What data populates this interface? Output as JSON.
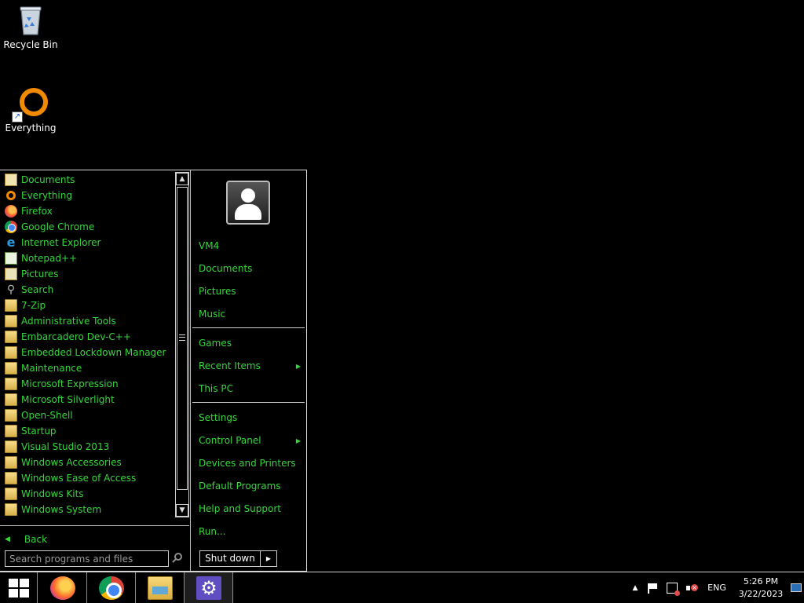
{
  "desktop": {
    "icons": [
      {
        "label": "Recycle Bin",
        "icon": "recycle-bin-icon"
      },
      {
        "label": "Everything",
        "icon": "everything-icon"
      }
    ]
  },
  "start_menu": {
    "programs": [
      {
        "label": "Documents",
        "icon": "documents-icon"
      },
      {
        "label": "Everything",
        "icon": "everything-icon"
      },
      {
        "label": "Firefox",
        "icon": "firefox-icon"
      },
      {
        "label": "Google Chrome",
        "icon": "chrome-icon"
      },
      {
        "label": "Internet Explorer",
        "icon": "internet-explorer-icon"
      },
      {
        "label": "Notepad++",
        "icon": "notepad-icon"
      },
      {
        "label": "Pictures",
        "icon": "pictures-icon"
      },
      {
        "label": "Search",
        "icon": "search-icon"
      },
      {
        "label": "7-Zip",
        "icon": "folder-icon"
      },
      {
        "label": "Administrative Tools",
        "icon": "folder-icon"
      },
      {
        "label": "Embarcadero Dev-C++",
        "icon": "folder-icon"
      },
      {
        "label": "Embedded Lockdown Manager",
        "icon": "folder-icon"
      },
      {
        "label": "Maintenance",
        "icon": "folder-icon"
      },
      {
        "label": "Microsoft Expression",
        "icon": "folder-icon"
      },
      {
        "label": "Microsoft Silverlight",
        "icon": "folder-icon"
      },
      {
        "label": "Open-Shell",
        "icon": "folder-icon"
      },
      {
        "label": "Startup",
        "icon": "folder-icon"
      },
      {
        "label": "Visual Studio 2013",
        "icon": "folder-icon"
      },
      {
        "label": "Windows Accessories",
        "icon": "folder-icon"
      },
      {
        "label": "Windows Ease of Access",
        "icon": "folder-icon"
      },
      {
        "label": "Windows Kits",
        "icon": "folder-icon"
      },
      {
        "label": "Windows System",
        "icon": "folder-icon"
      }
    ],
    "back_label": "Back",
    "search_placeholder": "Search programs and files",
    "right_pane": {
      "user_name": "VM4",
      "group1": [
        "Documents",
        "Pictures",
        "Music"
      ],
      "group2": [
        {
          "label": "Games",
          "submenu": false
        },
        {
          "label": "Recent Items",
          "submenu": true
        },
        {
          "label": "This PC",
          "submenu": false
        }
      ],
      "group3": [
        {
          "label": "Settings",
          "submenu": false
        },
        {
          "label": "Control Panel",
          "submenu": true
        },
        {
          "label": "Devices and Printers",
          "submenu": false
        },
        {
          "label": "Default Programs",
          "submenu": false
        },
        {
          "label": "Help and Support",
          "submenu": false
        },
        {
          "label": "Run...",
          "submenu": false
        }
      ],
      "shutdown_label": "Shut down"
    }
  },
  "taskbar": {
    "pinned": [
      "firefox-icon",
      "chrome-icon",
      "file-explorer-icon",
      "settings-icon"
    ],
    "tray": {
      "language": "ENG",
      "time": "5:26 PM",
      "date": "3/22/2023"
    }
  },
  "colors": {
    "menu_text": "#36d63b",
    "background": "#000000",
    "border": "#cfcfcf"
  }
}
